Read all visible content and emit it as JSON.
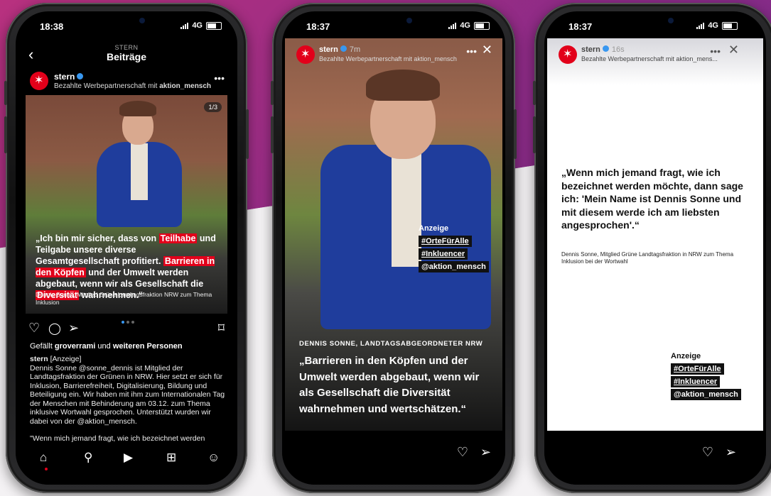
{
  "phones": {
    "feed": {
      "status_time": "18:38",
      "network": "4G",
      "header_sub": "STERN",
      "header_title": "Beiträge",
      "account": "stern",
      "sponsored_prefix": "Bezahlte Werbepartnerschaft mit",
      "sponsored_partner": "aktion_mensch",
      "slide_count": "1/3",
      "quote_parts": [
        "„Ich bin mir sicher, dass von ",
        "Teilhabe",
        " und Teilgabe unsere diverse Gesamtgesellschaft profitiert. ",
        "Barrieren in den Köpfen",
        " und der Umwelt werden abgebaut, wenn wir als Gesellschaft die ",
        "Diversität",
        " wahrnehmen.“"
      ],
      "credit": "Dennis Sonne, Mitglied Grüne Landtagsfraktion NRW zum Thema Inklusion",
      "likes_prefix": "Gefällt",
      "likes_user": "groverrami",
      "likes_and": "und",
      "likes_others": "weiteren Personen",
      "caption_account": "stern",
      "caption_tag": "[Anzeige]",
      "caption_text": "Dennis Sonne @sonne_dennis ist Mitglied der Landtagsfraktion der Grünen in NRW. Hier setzt er sich für Inklusion, Barrierefreiheit, Digitalisierung, Bildung und Beteiligung ein. Wir haben mit ihm zum Internationalen Tag der Menschen mit Behinderung am 03.12. zum Thema inklusive Wortwahl gesprochen. Unterstützt wurden wir dabei von der @aktion_mensch.",
      "caption_more": "\"Wenn mich jemand fragt, wie ich bezeichnet werden möchte, dann sag ich: 'Mein Name ist Dennis Sonne und"
    },
    "story1": {
      "status_time": "18:37",
      "network": "4G",
      "account": "stern",
      "time_ago": "7m",
      "sponsored": "Bezahlte Werbepartnerschaft mit aktion_mensch",
      "ad_label": "Anzeige",
      "tags": [
        "#OrteFürAlle",
        "#Inkluencer",
        "@aktion_mensch"
      ],
      "kicker": "DENNIS SONNE, LANDTAGSABGEORDNETER NRW",
      "quote": "„Barrieren in den Köpfen und der Umwelt werden abgebaut, wenn wir als Gesellschaft die Diversität wahrnehmen und wertschätzen.“"
    },
    "story2": {
      "status_time": "18:37",
      "network": "4G",
      "account": "stern",
      "time_ago": "16s",
      "sponsored": "Bezahlte Werbepartnerschaft mit aktion_mens...",
      "quote": "„Wenn mich jemand fragt, wie ich bezeichnet werden möchte, dann sage ich: 'Mein Name ist Dennis Sonne und mit diesem werde ich am liebsten angesprochen'.“",
      "credit": "Dennis Sonne, Mitglied Grüne Landtagsfraktion in NRW zum Thema Inklusion bei der Wortwahl",
      "ad_label": "Anzeige",
      "tags": [
        "#OrteFürAlle",
        "#Inkluencer",
        "@aktion_mensch"
      ]
    }
  },
  "colors": {
    "brand_red": "#e2001a",
    "accent_purple": "#8f2b86",
    "ig_blue": "#3897f0"
  },
  "icons": [
    "back-icon",
    "more-icon",
    "heart-icon",
    "comment-icon",
    "share-icon",
    "bookmark-icon",
    "home-icon",
    "search-icon",
    "reels-icon",
    "shop-icon",
    "profile-icon",
    "close-icon"
  ]
}
